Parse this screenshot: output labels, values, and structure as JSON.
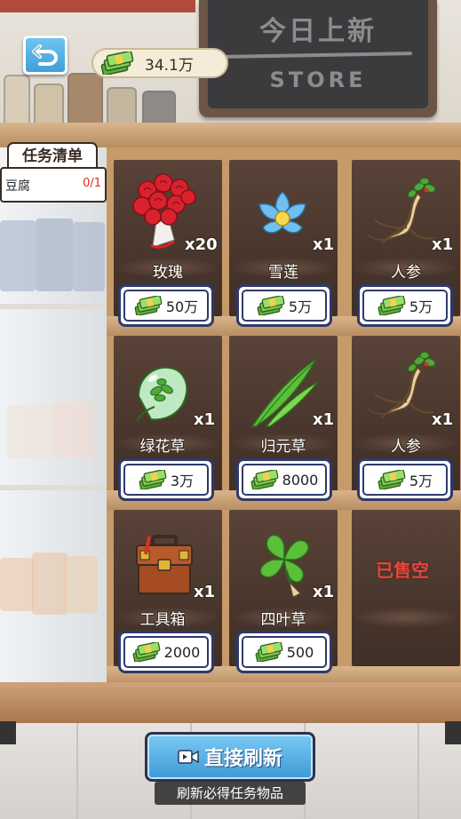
{
  "hud": {
    "money": "34.1万",
    "money_icon": "cash-stack-icon",
    "back_icon": "undo-arrow-icon"
  },
  "store_sign": {
    "title": "今日上新",
    "subtitle": "STORE"
  },
  "task_list": {
    "title": "任务清单",
    "items": [
      {
        "name": "豆腐",
        "progress": "0/1"
      }
    ]
  },
  "items": [
    {
      "name": "玫瑰",
      "qty": "x20",
      "price": "50万",
      "icon": "rose-bouquet-icon"
    },
    {
      "name": "雪莲",
      "qty": "x1",
      "price": "5万",
      "icon": "snow-lotus-icon"
    },
    {
      "name": "人参",
      "qty": "x1",
      "price": "5万",
      "icon": "ginseng-icon"
    },
    {
      "name": "绿花草",
      "qty": "x1",
      "price": "3万",
      "icon": "green-herb-orb-icon"
    },
    {
      "name": "归元草",
      "qty": "x1",
      "price": "8000",
      "icon": "grass-blade-icon"
    },
    {
      "name": "人参",
      "qty": "x1",
      "price": "5万",
      "icon": "ginseng-icon"
    },
    {
      "name": "工具箱",
      "qty": "x1",
      "price": "2000",
      "icon": "toolbox-icon"
    },
    {
      "name": "四叶草",
      "qty": "x1",
      "price": "500",
      "icon": "four-leaf-clover-icon"
    }
  ],
  "sold_out_label": "已售空",
  "refresh": {
    "label": "直接刷新",
    "icon": "video-ad-icon",
    "hint": "刷新必得任务物品"
  },
  "colors": {
    "button_blue": "#3f99d6",
    "price_border": "#2f3a6a",
    "sold_out": "#e8443a",
    "task_progress": "#d8321f"
  }
}
